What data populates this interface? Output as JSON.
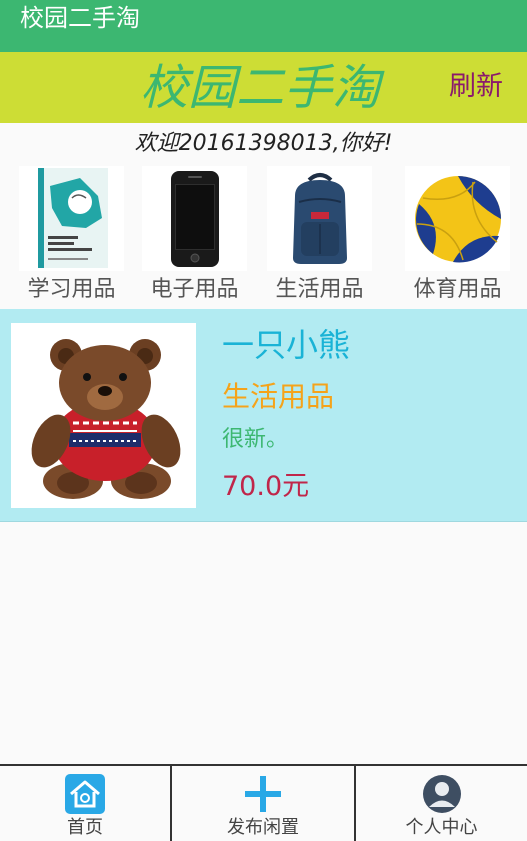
{
  "titlebar": {
    "title": "校园二手淘"
  },
  "header": {
    "brand": "校园二手淘",
    "refresh": "刷新"
  },
  "welcome": "欢迎20161398013,你好!",
  "categories": [
    {
      "label": "学习用品",
      "icon": "book-icon"
    },
    {
      "label": "电子用品",
      "icon": "phone-icon"
    },
    {
      "label": "生活用品",
      "icon": "backpack-icon"
    },
    {
      "label": "体育用品",
      "icon": "volleyball-icon"
    }
  ],
  "item": {
    "name": "一只小熊",
    "category": "生活用品",
    "description": "很新。",
    "price": "70.0元",
    "image": "teddy-bear-icon"
  },
  "bottom_nav": [
    {
      "label": "首页",
      "icon": "home-icon"
    },
    {
      "label": "发布闲置",
      "icon": "plus-icon"
    },
    {
      "label": "个人中心",
      "icon": "user-icon"
    }
  ],
  "colors": {
    "titlebar": "#3cb771",
    "header": "#cddd35",
    "card": "#b2ebf2",
    "price": "#c0264a",
    "refresh": "#8b1a6b"
  }
}
